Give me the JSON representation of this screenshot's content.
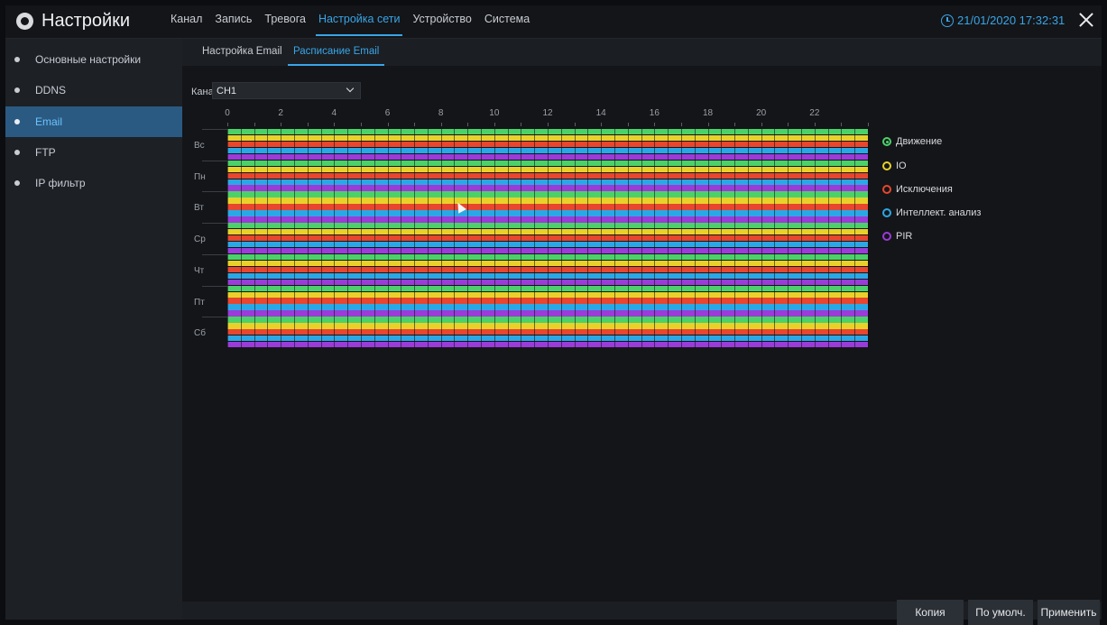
{
  "header": {
    "title": "Настройки",
    "tabs": [
      {
        "label": "Канал",
        "active": false
      },
      {
        "label": "Запись",
        "active": false
      },
      {
        "label": "Тревога",
        "active": false
      },
      {
        "label": "Настройка сети",
        "active": true
      },
      {
        "label": "Устройство",
        "active": false
      },
      {
        "label": "Система",
        "active": false
      }
    ],
    "datetime": "21/01/2020 17:32:31"
  },
  "sidebar": {
    "items": [
      {
        "label": "Основные настройки",
        "active": false
      },
      {
        "label": "DDNS",
        "active": false
      },
      {
        "label": "Email",
        "active": true
      },
      {
        "label": "FTP",
        "active": false
      },
      {
        "label": "IP фильтр",
        "active": false
      }
    ]
  },
  "subtabs": [
    {
      "label": "Настройка Email",
      "active": false
    },
    {
      "label": "Расписание Email",
      "active": true
    }
  ],
  "channel": {
    "label": "Канал",
    "value": "CH1"
  },
  "schedule": {
    "hour_labels": [
      "0",
      "2",
      "4",
      "6",
      "8",
      "10",
      "12",
      "14",
      "16",
      "18",
      "20",
      "22"
    ],
    "days": [
      "Вс",
      "Пн",
      "Вт",
      "Ср",
      "Чт",
      "Пт",
      "Сб"
    ]
  },
  "legend": [
    {
      "label": "Движение",
      "color": "#4cd16a",
      "selected": true
    },
    {
      "label": "IO",
      "color": "#e8d22a",
      "selected": false
    },
    {
      "label": "Исключения",
      "color": "#e8462e",
      "selected": false
    },
    {
      "label": "Интеллект. анализ",
      "color": "#2aa8e6",
      "selected": false
    },
    {
      "label": "PIR",
      "color": "#9b3bd8",
      "selected": false
    }
  ],
  "buttons": {
    "copy": "Копия",
    "default": "По умолч.",
    "apply": "Применить"
  }
}
